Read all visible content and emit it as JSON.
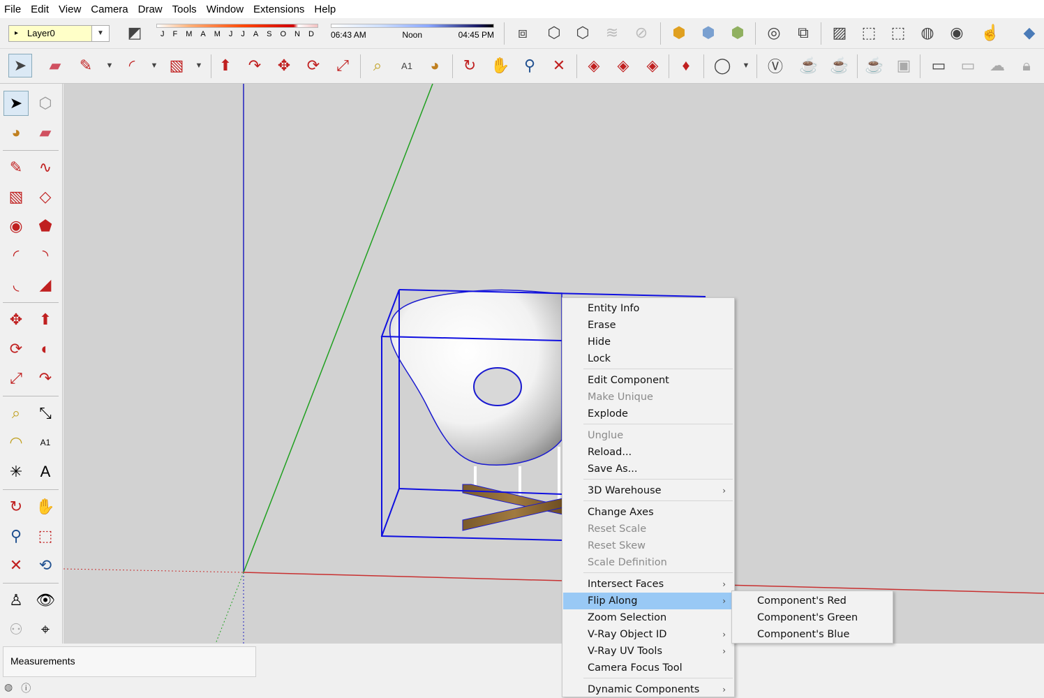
{
  "menubar": [
    "File",
    "Edit",
    "View",
    "Camera",
    "Draw",
    "Tools",
    "Window",
    "Extensions",
    "Help"
  ],
  "layer": {
    "name": "Layer0"
  },
  "shadow": {
    "months": [
      "J",
      "F",
      "M",
      "A",
      "M",
      "J",
      "J",
      "A",
      "S",
      "O",
      "N",
      "D"
    ],
    "time_start": "06:43 AM",
    "time_mid": "Noon",
    "time_end": "04:45 PM"
  },
  "measurements_label": "Measurements",
  "context_menu": {
    "items": [
      {
        "label": "Entity Info",
        "enabled": true
      },
      {
        "label": "Erase",
        "enabled": true
      },
      {
        "label": "Hide",
        "enabled": true
      },
      {
        "label": "Lock",
        "enabled": true
      },
      {
        "label": "Edit Component",
        "enabled": true
      },
      {
        "label": "Make Unique",
        "enabled": false
      },
      {
        "label": "Explode",
        "enabled": true
      },
      {
        "label": "Unglue",
        "enabled": false
      },
      {
        "label": "Reload...",
        "enabled": true
      },
      {
        "label": "Save As...",
        "enabled": true
      },
      {
        "label": "3D Warehouse",
        "enabled": true,
        "submenu": true
      },
      {
        "label": "Change Axes",
        "enabled": true
      },
      {
        "label": "Reset Scale",
        "enabled": false
      },
      {
        "label": "Reset Skew",
        "enabled": false
      },
      {
        "label": "Scale Definition",
        "enabled": false
      },
      {
        "label": "Intersect Faces",
        "enabled": true,
        "submenu": true
      },
      {
        "label": "Flip Along",
        "enabled": true,
        "submenu": true,
        "selected": true
      },
      {
        "label": "Zoom Selection",
        "enabled": true
      },
      {
        "label": "V-Ray Object ID",
        "enabled": true,
        "submenu": true
      },
      {
        "label": "V-Ray UV Tools",
        "enabled": true,
        "submenu": true
      },
      {
        "label": "Camera Focus Tool",
        "enabled": true
      },
      {
        "label": "Dynamic Components",
        "enabled": true,
        "submenu": true
      }
    ],
    "arrow": "›"
  },
  "flip_submenu": [
    "Component's Red",
    "Component's Green",
    "Component's Blue"
  ],
  "colors": {
    "selection_blue": "#1010e0",
    "axis_red": "#c83030",
    "axis_green": "#20a020",
    "axis_blue": "#2020c0",
    "highlight": "#99c9f5"
  }
}
